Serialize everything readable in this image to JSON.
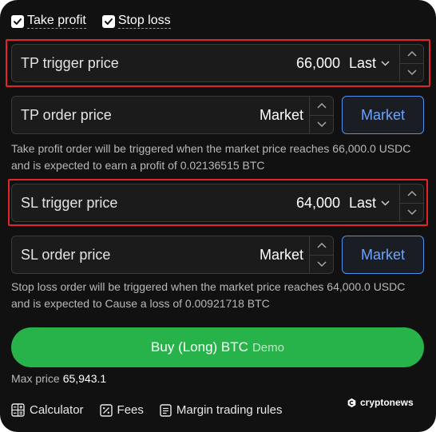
{
  "checkboxes": {
    "take_profit": {
      "label": "Take profit",
      "checked": true
    },
    "stop_loss": {
      "label": "Stop loss",
      "checked": true
    }
  },
  "tp_trigger": {
    "label": "TP trigger price",
    "value": "66,000",
    "mode": "Last"
  },
  "tp_order": {
    "label": "TP order price",
    "value": "Market",
    "market_button": "Market"
  },
  "tp_info": "Take profit order will be triggered when the market price reaches 66,000.0 USDC and is expected to earn a profit of 0.02136515 BTC",
  "sl_trigger": {
    "label": "SL trigger price",
    "value": "64,000",
    "mode": "Last"
  },
  "sl_order": {
    "label": "SL order price",
    "value": "Market",
    "market_button": "Market"
  },
  "sl_info": "Stop loss order will be triggered when the market price reaches 64,000.0 USDC and is expected to Cause a loss of 0.00921718 BTC",
  "buy_button": {
    "label": "Buy (Long) BTC",
    "tag": "Demo"
  },
  "max_price": {
    "label": "Max price",
    "value": "65,943.1"
  },
  "footer": {
    "calculator": "Calculator",
    "fees": "Fees",
    "rules": "Margin trading rules"
  },
  "brand": "cryptonews",
  "colors": {
    "background": "#111111",
    "accent_blue": "#4f8ff2",
    "buy_green": "#27b24a",
    "highlight_red": "#e0262b"
  },
  "icons": [
    "checkbox-checked-icon",
    "chevron-down-icon",
    "chevron-up-icon",
    "calculator-icon",
    "percent-icon",
    "document-icon",
    "cryptonews-logo-icon"
  ]
}
